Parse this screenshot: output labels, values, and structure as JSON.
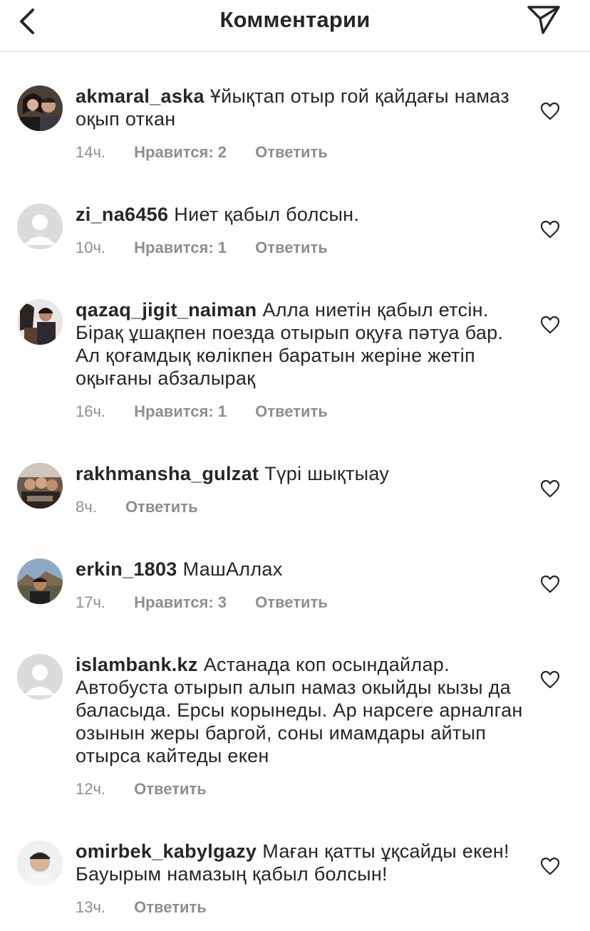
{
  "header": {
    "title": "Комментарии"
  },
  "comments": [
    {
      "user": "akmaral_aska",
      "text": "Ұйықтап отыр гой қайдағы намаз оқып откан",
      "time": "14ч.",
      "likes": "Нравится: 2",
      "reply": "Ответить",
      "avatar": "photo"
    },
    {
      "user": "zi_na6456",
      "text": "Ниет қабыл болсын.",
      "time": "10ч.",
      "likes": "Нравится: 1",
      "reply": "Ответить",
      "avatar": "default"
    },
    {
      "user": "qazaq_jigit_naiman",
      "text": "Алла ниетін қабыл етсін. Бірақ ұшақпен поезда отырып оқуға пәтуа бар. Ал қоғамдық көлікпен баратын жеріне жетіп оқығаны абзалырақ",
      "time": "16ч.",
      "likes": "Нравится: 1",
      "reply": "Ответить",
      "avatar": "photo"
    },
    {
      "user": "rakhmansha_gulzat",
      "text": "Түрі шықтыау",
      "time": "8ч.",
      "likes": "",
      "reply": "Ответить",
      "avatar": "photo"
    },
    {
      "user": "erkin_1803",
      "text": "МашАллах",
      "time": "17ч.",
      "likes": "Нравится: 3",
      "reply": "Ответить",
      "avatar": "photo"
    },
    {
      "user": "islambank.kz",
      "text": "Астанада коп осындайлар. Автобуста отырып алып намаз окыйды кызы да баласыда. Ерсы корынеды. Ар нарсеге арналган озынын жеры баргой, соны имамдары айтып отырса кайтеды екен",
      "time": "12ч.",
      "likes": "",
      "reply": "Ответить",
      "avatar": "default"
    },
    {
      "user": "omirbek_kabylgazy",
      "text": "Маған қатты ұқсайды екен! Бауырым намазың қабыл болсын!",
      "time": "13ч.",
      "likes": "",
      "reply": "Ответить",
      "avatar": "photo"
    }
  ]
}
